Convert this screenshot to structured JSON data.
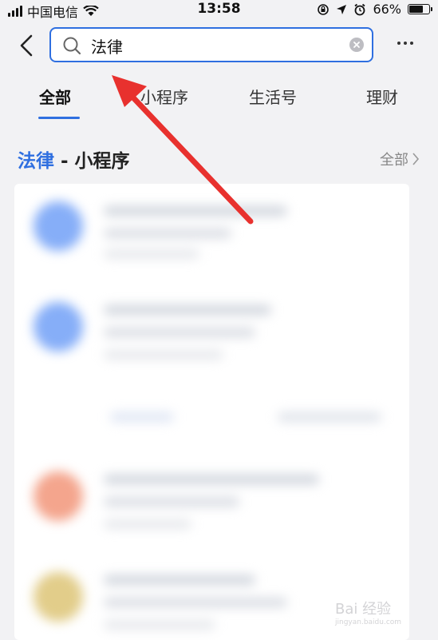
{
  "status_bar": {
    "carrier": "中国电信",
    "time": "13:58",
    "battery": "66%",
    "battery_level": 0.66
  },
  "search": {
    "query": "法律"
  },
  "tabs": [
    {
      "label": "全部",
      "active": true
    },
    {
      "label": "小程序",
      "active": false
    },
    {
      "label": "生活号",
      "active": false
    },
    {
      "label": "理财",
      "active": false
    }
  ],
  "section": {
    "keyword": "法律",
    "title_rest": " - 小程序",
    "more_label": "全部"
  },
  "colors": {
    "accent": "#2f6fe0",
    "annotation_arrow": "#e8312e"
  },
  "watermark": {
    "text": "Bai 经验",
    "sub": "jingyan.baidu.com"
  }
}
